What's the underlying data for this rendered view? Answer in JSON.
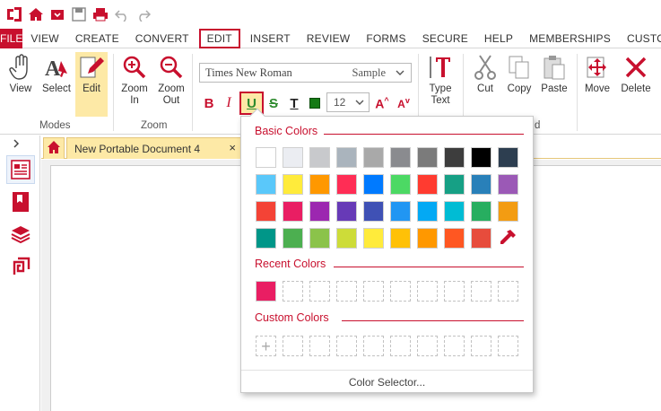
{
  "menu": {
    "file": "FILE",
    "items": [
      "VIEW",
      "CREATE",
      "CONVERT",
      "EDIT",
      "INSERT",
      "REVIEW",
      "FORMS",
      "SECURE",
      "HELP",
      "MEMBERSHIPS",
      "CUSTOM"
    ],
    "active": "EDIT"
  },
  "ribbon": {
    "modes_group": "Modes",
    "zoom_group": "Zoom",
    "view": "View",
    "select": "Select",
    "edit": "Edit",
    "zoom_in_1": "Zoom",
    "zoom_in_2": "In",
    "zoom_out_1": "Zoom",
    "zoom_out_2": "Out",
    "font_name": "Times New Roman",
    "font_sample": "Sample",
    "font_size": "12",
    "type_text_1": "Type",
    "type_text_2": "Text",
    "cut": "Cut",
    "copy": "Copy",
    "paste": "Paste",
    "move": "Move",
    "delete": "Delete",
    "group_label_partial": "d"
  },
  "tabs": {
    "document": "New Portable Document 4",
    "close": "×"
  },
  "color_popup": {
    "basic_title": "Basic Colors",
    "recent_title": "Recent Colors",
    "custom_title": "Custom Colors",
    "footer": "Color Selector...",
    "add_symbol": "+",
    "basic_colors": [
      [
        "#ffffff",
        "#ebedf2",
        "#c8c9cc",
        "#aab4bd",
        "#a9a9a9",
        "#8a8b8f",
        "#7b7b7b",
        "#3d3d3d",
        "#000000",
        "#2d3e50"
      ],
      [
        "#5ac8fa",
        "#ffeb3b",
        "#ff9800",
        "#ff2d55",
        "#007aff",
        "#4cd964",
        "#ff3b30",
        "#16a085",
        "#2980b9",
        "#9b59b6"
      ],
      [
        "#f44336",
        "#e91e63",
        "#9c27b0",
        "#673ab7",
        "#3f51b5",
        "#2196f3",
        "#03a9f4",
        "#00bcd4",
        "#27ae60",
        "#f39c12"
      ],
      [
        "#009688",
        "#4caf50",
        "#8bc34a",
        "#cddc39",
        "#ffeb3b",
        "#ffc107",
        "#ff9800",
        "#ff5722",
        "#e74c3c"
      ]
    ],
    "recent_colors": [
      "#e91e63"
    ],
    "accent": "#c8102e"
  },
  "icons": {
    "eyedropper": "eyedropper-icon"
  }
}
